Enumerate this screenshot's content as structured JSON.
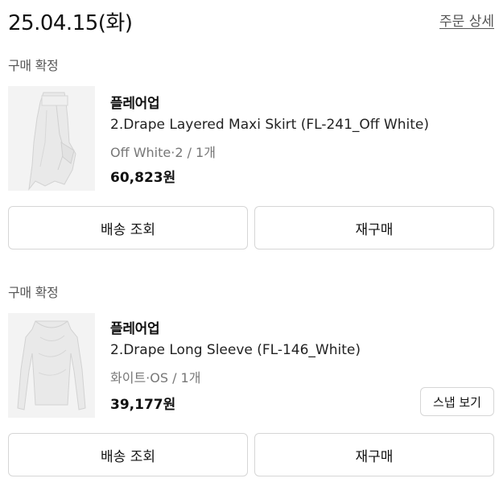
{
  "header": {
    "date": "25.04.15(화)",
    "detail_link": "주문 상세"
  },
  "orders": [
    {
      "status": "구매 확정",
      "brand": "플레어업",
      "product_name": "2.Drape Layered Maxi Skirt (FL-241_Off White)",
      "option": "Off White·2 / 1개",
      "price": "60,823원",
      "image_icon": "skirt-product-image",
      "buttons": {
        "shipping": "배송 조회",
        "rebuy": "재구매"
      }
    },
    {
      "status": "구매 확정",
      "brand": "플레어업",
      "product_name": "2.Drape Long Sleeve (FL-146_White)",
      "option": "화이트·OS / 1개",
      "price": "39,177원",
      "image_icon": "long-sleeve-product-image",
      "snap_button": "스냅 보기",
      "buttons": {
        "shipping": "배송 조회",
        "rebuy": "재구매"
      }
    }
  ]
}
